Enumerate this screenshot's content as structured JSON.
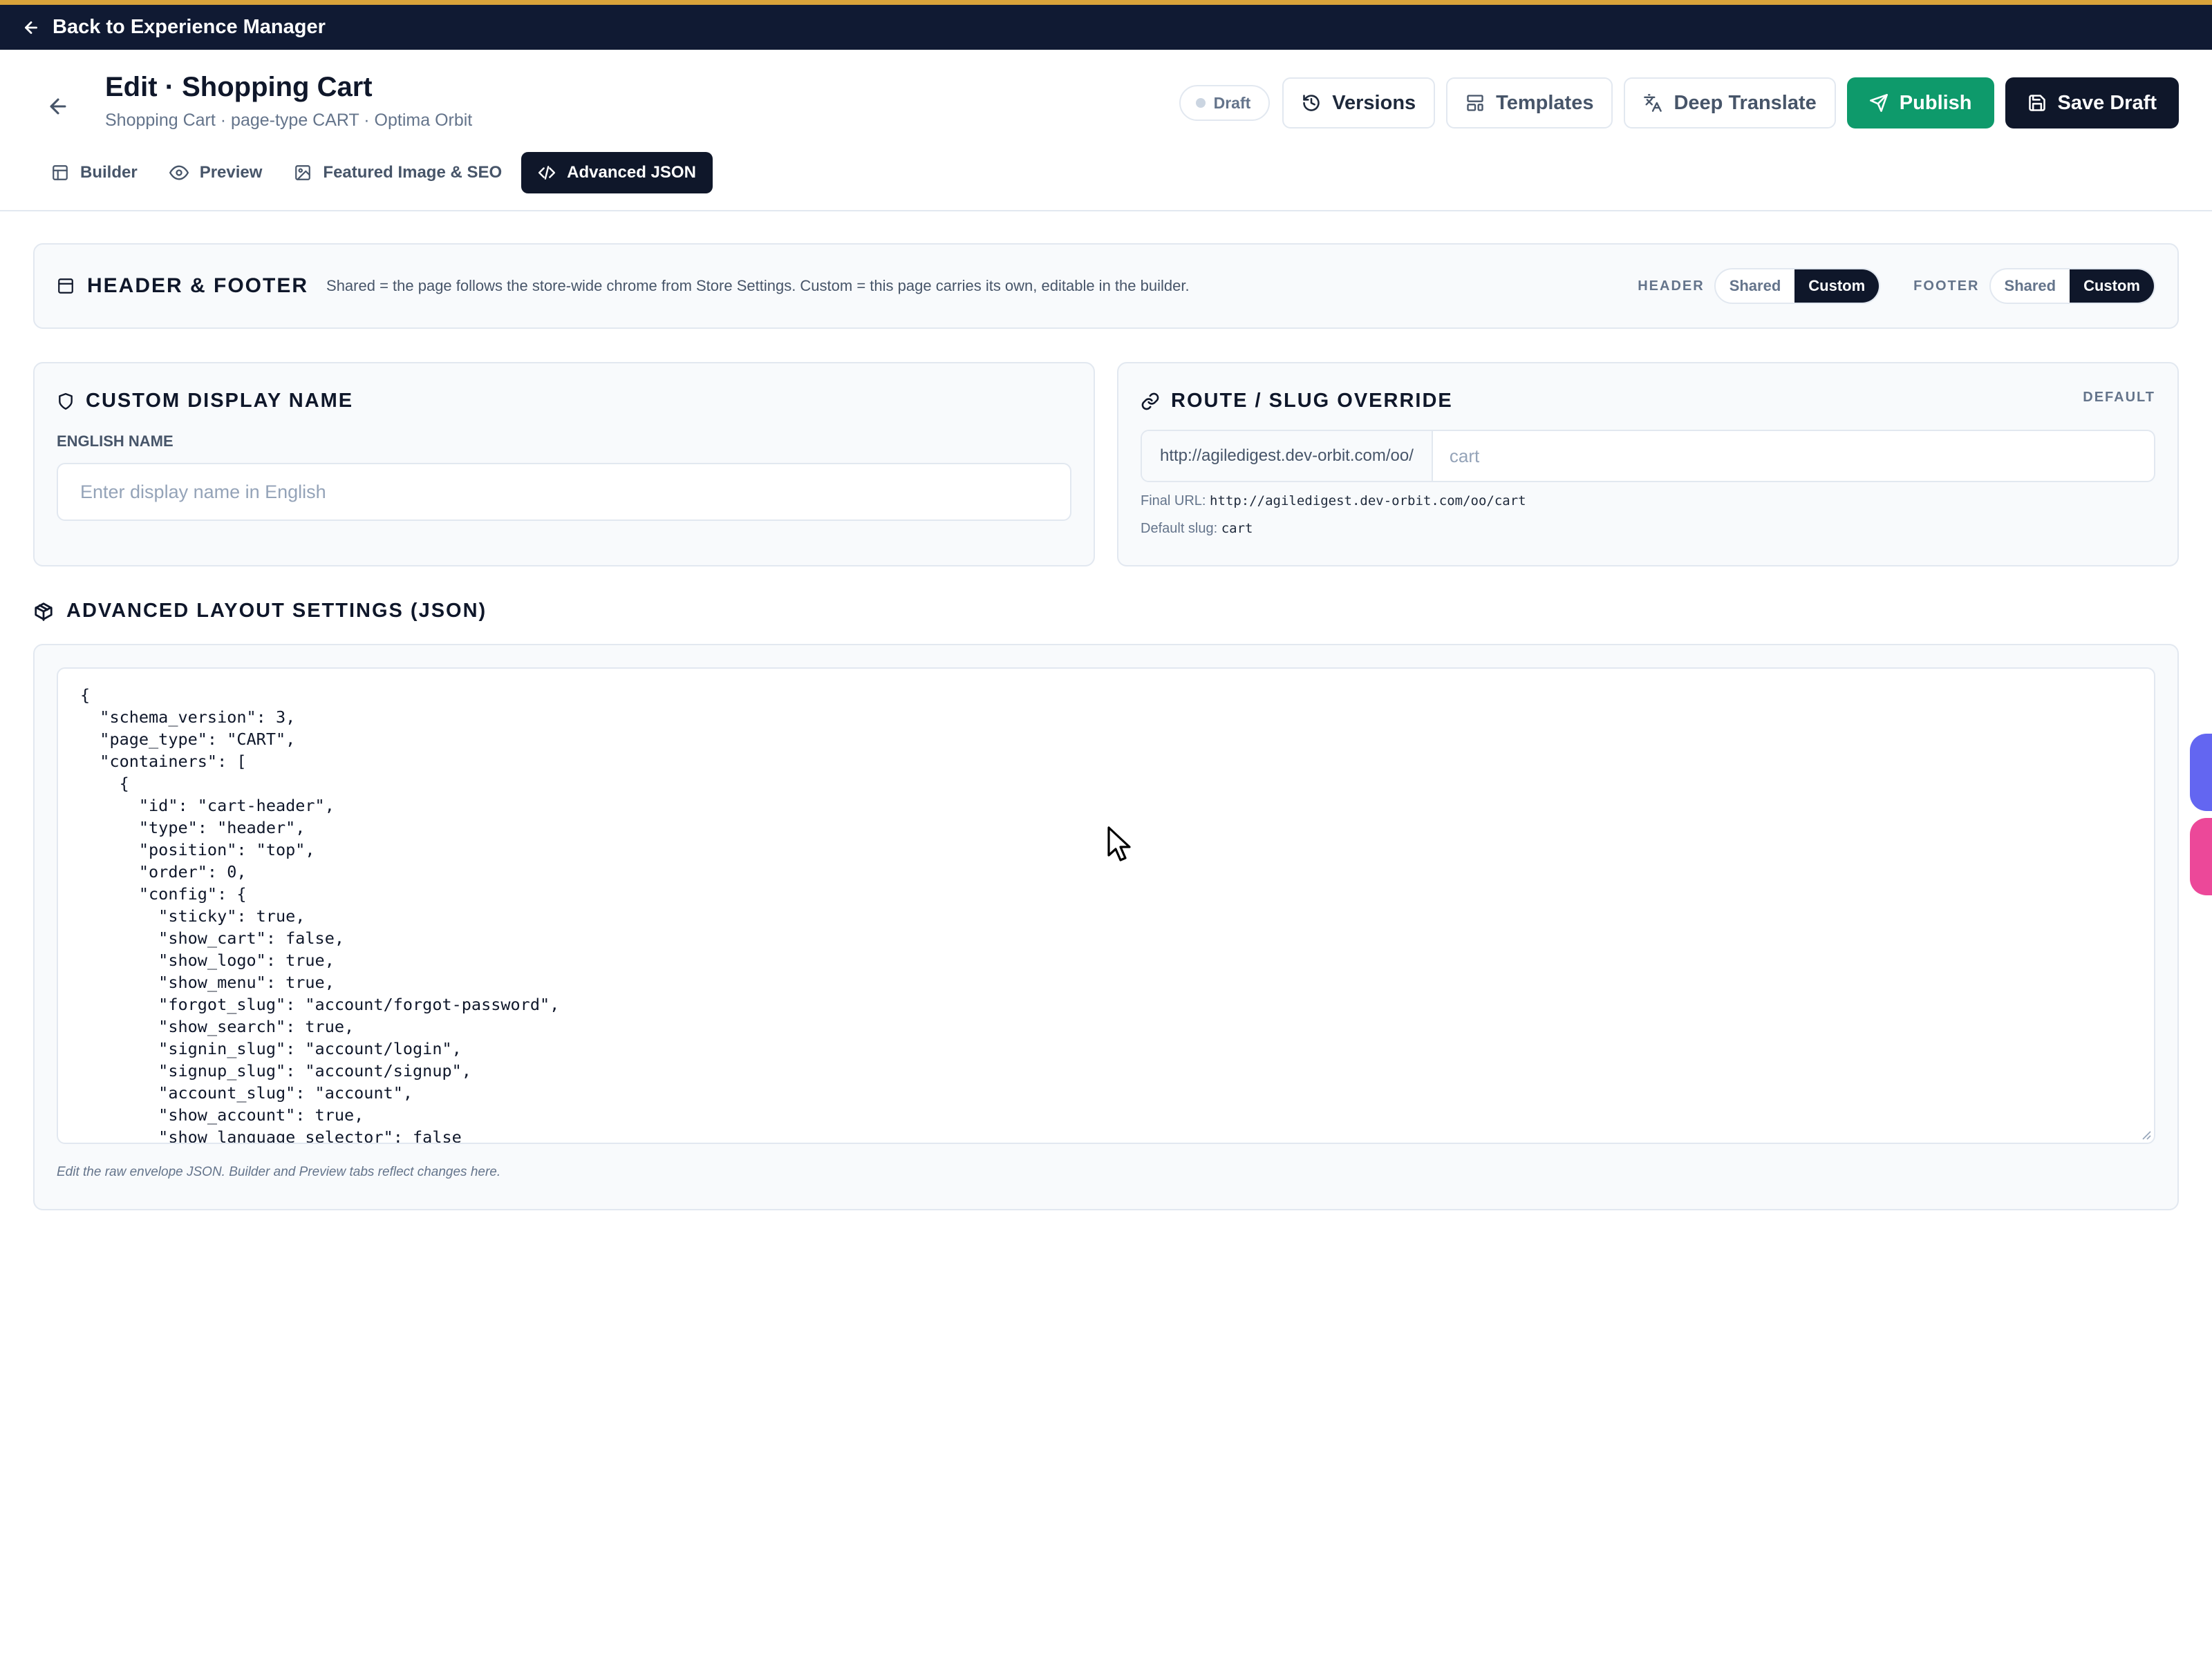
{
  "topbar": {
    "back_label": "Back to Experience Manager"
  },
  "header": {
    "title": "Edit · Shopping Cart",
    "subtitle": "Shopping Cart · page-type CART · Optima Orbit",
    "status": "Draft",
    "buttons": {
      "versions": "Versions",
      "templates": "Templates",
      "deep_translate": "Deep Translate",
      "publish": "Publish",
      "save_draft": "Save Draft"
    }
  },
  "tabs": [
    {
      "label": "Builder"
    },
    {
      "label": "Preview"
    },
    {
      "label": "Featured Image & SEO"
    },
    {
      "label": "Advanced JSON",
      "active": true
    }
  ],
  "header_footer": {
    "title": "HEADER & FOOTER",
    "description": "Shared = the page follows the store-wide chrome from Store Settings. Custom = this page carries its own, editable in the builder.",
    "header_label": "HEADER",
    "footer_label": "FOOTER",
    "shared": "Shared",
    "custom": "Custom",
    "header_selected": "Custom",
    "footer_selected": "Custom"
  },
  "display_name": {
    "title": "CUSTOM DISPLAY NAME",
    "field_label": "ENGLISH NAME",
    "placeholder": "Enter display name in English",
    "value": ""
  },
  "route": {
    "title": "ROUTE / SLUG OVERRIDE",
    "badge": "DEFAULT",
    "prefix": "http://agiledigest.dev-orbit.com/oo/",
    "placeholder": "cart",
    "final_url_label": "Final URL:",
    "final_url": "http://agiledigest.dev-orbit.com/oo/cart",
    "default_slug_label": "Default slug:",
    "default_slug": "cart"
  },
  "advanced": {
    "title": "ADVANCED LAYOUT SETTINGS (JSON)",
    "json_text": "{\n  \"schema_version\": 3,\n  \"page_type\": \"CART\",\n  \"containers\": [\n    {\n      \"id\": \"cart-header\",\n      \"type\": \"header\",\n      \"position\": \"top\",\n      \"order\": 0,\n      \"config\": {\n        \"sticky\": true,\n        \"show_cart\": false,\n        \"show_logo\": true,\n        \"show_menu\": true,\n        \"forgot_slug\": \"account/forgot-password\",\n        \"show_search\": true,\n        \"signin_slug\": \"account/login\",\n        \"signup_slug\": \"account/signup\",\n        \"account_slug\": \"account\",\n        \"show_account\": true,\n        \"show_language_selector\": false",
    "help": "Edit the raw envelope JSON. Builder and Preview tabs reflect changes here."
  },
  "colors": {
    "topbar_bg": "#101a33",
    "topbar_accent": "#d9a33a",
    "primary_dark": "#0f172a",
    "publish_green": "#0e9a6b",
    "float_indigo": "#6366f1",
    "float_pink": "#ec4899"
  },
  "icons": {
    "back": "arrow-left-icon",
    "versions": "history-icon",
    "templates": "layout-template-icon",
    "deep_translate": "languages-icon",
    "publish": "send-icon",
    "save_draft": "save-icon",
    "builder": "layout-icon",
    "preview": "eye-icon",
    "featured_image": "image-icon",
    "advanced_json": "code-icon",
    "header_footer": "panel-icon",
    "display_name": "shield-icon",
    "route": "link-icon",
    "advanced": "package-icon"
  }
}
